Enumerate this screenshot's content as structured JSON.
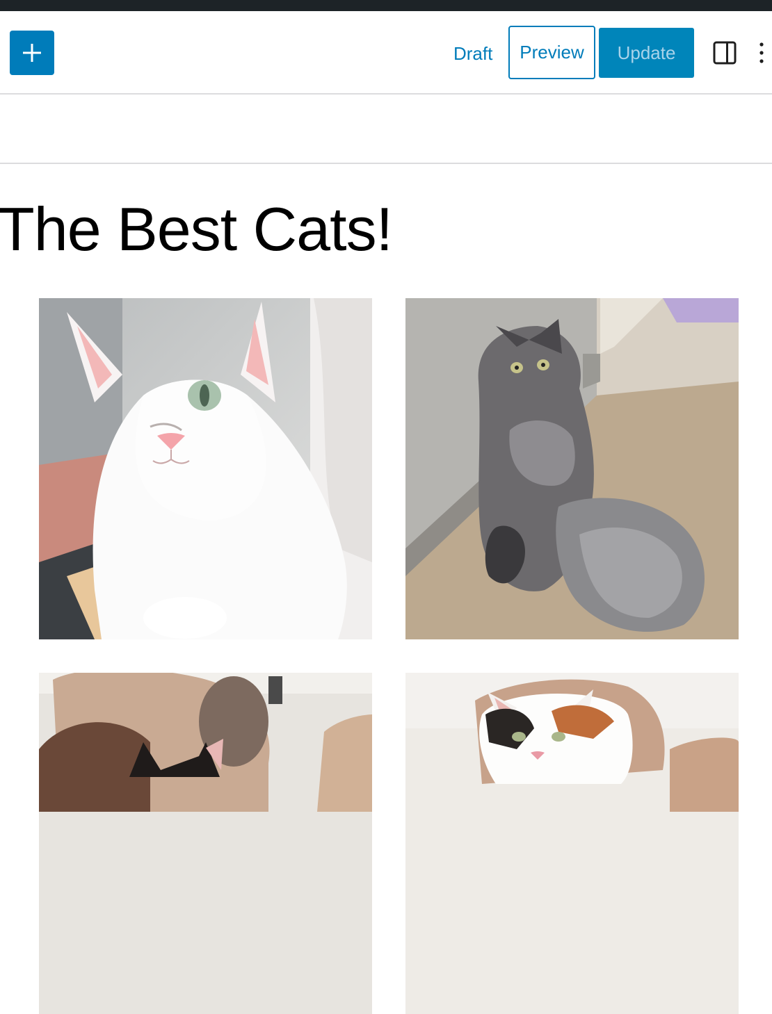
{
  "toolbar": {
    "inserter_icon": "plus-icon",
    "draft_label": "Draft",
    "preview_label": "Preview",
    "update_label": "Update",
    "settings_icon": "sidebar-toggle-icon",
    "options_icon": "vertical-ellipsis-icon"
  },
  "post": {
    "title": "The Best Cats!"
  },
  "gallery": {
    "images": [
      {
        "depicts": "white-cat"
      },
      {
        "depicts": "grey-fluffy-cat"
      },
      {
        "depicts": "black-and-white-cat"
      },
      {
        "depicts": "calico-cat"
      }
    ]
  },
  "colors": {
    "accent": "#007cba",
    "admin_bar": "#1d2327",
    "update_disabled_text": "#a8d3ea",
    "divider": "#dcdcde"
  }
}
